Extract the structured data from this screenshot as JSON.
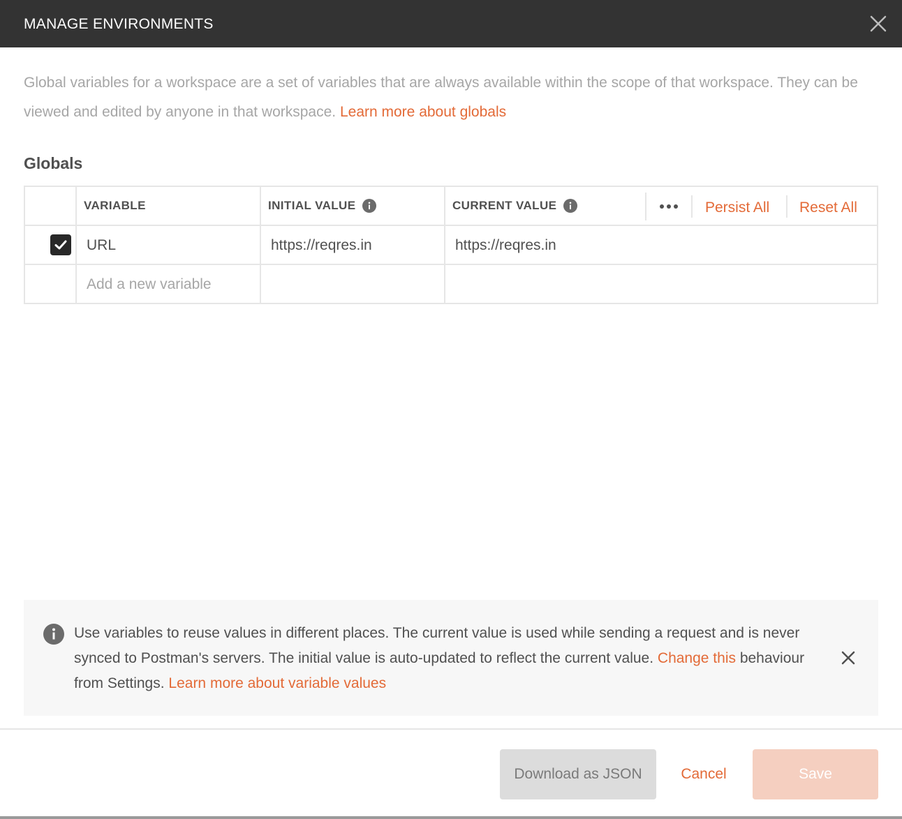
{
  "header": {
    "title": "MANAGE ENVIRONMENTS",
    "close_icon": "close-icon"
  },
  "description": {
    "text": "Global variables for a workspace are a set of variables that are always available within the scope of that workspace. They can be viewed and edited by anyone in that workspace.",
    "link": "Learn more about globals"
  },
  "section": {
    "title": "Globals"
  },
  "table": {
    "columns": {
      "variable": "VARIABLE",
      "initial_value": "INITIAL VALUE",
      "current_value": "CURRENT VALUE"
    },
    "actions": {
      "more_icon": "more-horizontal-icon",
      "persist_all": "Persist All",
      "reset_all": "Reset All"
    },
    "rows": [
      {
        "enabled": true,
        "variable": "URL",
        "initial_value": "https://reqres.in",
        "current_value": "https://reqres.in"
      }
    ],
    "new_row": {
      "placeholder": "Add a new variable"
    }
  },
  "banner": {
    "icon": "info-icon",
    "text_before": "Use variables to reuse values in different places. The current value is used while sending a request and is never synced to Postman's servers. The initial value is auto-updated to reflect the current value.",
    "link_change": "Change this",
    "text_middle": "behaviour from Settings.",
    "link_learn": "Learn more about variable values"
  },
  "footer": {
    "download_label": "Download as JSON",
    "cancel_label": "Cancel",
    "save_label": "Save"
  },
  "colors": {
    "header_bg": "#333333",
    "accent": "#e36a37",
    "muted_text": "#a6a6a6",
    "save_disabled_bg": "#f5cfc0"
  }
}
